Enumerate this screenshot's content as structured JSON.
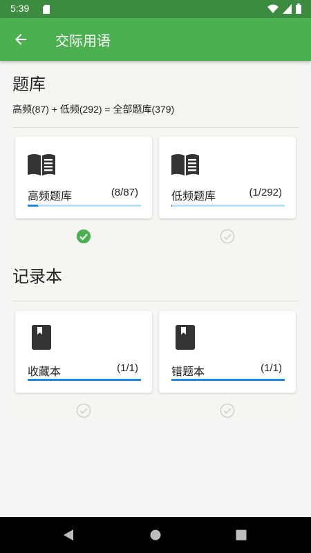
{
  "status_bar": {
    "time": "5:39"
  },
  "app_bar": {
    "title": "交际用语"
  },
  "question_bank": {
    "title": "题库",
    "summary": "高频(87) + 低频(292) = 全部题库(379)",
    "cards": [
      {
        "name": "高频题库",
        "count": "(8/87)",
        "progress": 0.092,
        "checked": true
      },
      {
        "name": "低频题库",
        "count": "(1/292)",
        "progress": 0.003,
        "checked": false
      }
    ]
  },
  "notebook": {
    "title": "记录本",
    "cards": [
      {
        "name": "收藏本",
        "count": "(1/1)",
        "progress": 1.0,
        "checked": false
      },
      {
        "name": "错题本",
        "count": "(1/1)",
        "progress": 1.0,
        "checked": false
      }
    ]
  },
  "colors": {
    "status_bar": "#3d8b40",
    "app_bar": "#4caf50",
    "progress_fill": "#1e88e5",
    "progress_track": "#bbdefb",
    "check_active": "#4caf50",
    "check_inactive": "#cfcfcf"
  },
  "icons": [
    "sd-card-icon",
    "wifi-icon",
    "signal-icon",
    "battery-icon",
    "back-arrow-icon",
    "open-book-icon",
    "bookmark-icon",
    "check-circle-icon",
    "nav-back-icon",
    "nav-home-icon",
    "nav-recents-icon"
  ]
}
